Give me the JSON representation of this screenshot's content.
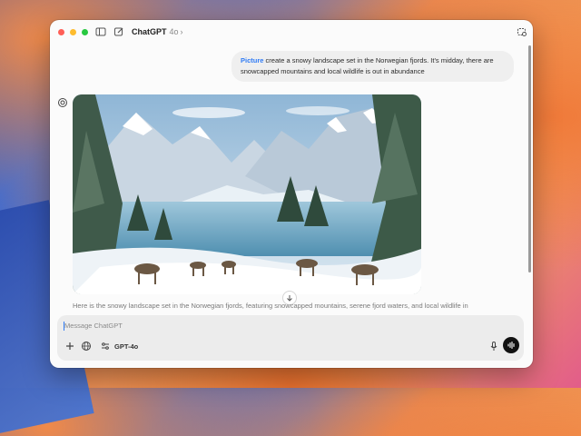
{
  "window": {
    "app_name": "ChatGPT",
    "model_version": "4o",
    "chevron": "›"
  },
  "icons": {
    "sidebar": "sidebar-toggle-icon",
    "new_chat": "new-chat-icon",
    "temporary": "temporary-chat-icon",
    "assistant": "openai-logo-icon",
    "scroll_down": "arrow-down-icon",
    "add": "plus-icon",
    "web": "globe-icon",
    "model": "sliders-icon",
    "mic": "microphone-icon",
    "voice": "voice-mode-icon"
  },
  "conversation": {
    "user_message": {
      "tag": "Picture",
      "text": "create a snowy landscape set in the Norwegian fjords. It's midday, there are snowcapped mountains and local wildlife is out in abundance"
    },
    "assistant_image_subject": "snowy Norwegian fjord landscape with reindeer",
    "assistant_caption": "Here is the snowy landscape set in the Norwegian fjords, featuring snowcapped mountains, serene fjord waters, and local wildlife in"
  },
  "composer": {
    "placeholder": "Message ChatGPT",
    "model_label": "GPT-4o"
  },
  "colors": {
    "accent": "#2f7bf5",
    "send": "#111111"
  }
}
